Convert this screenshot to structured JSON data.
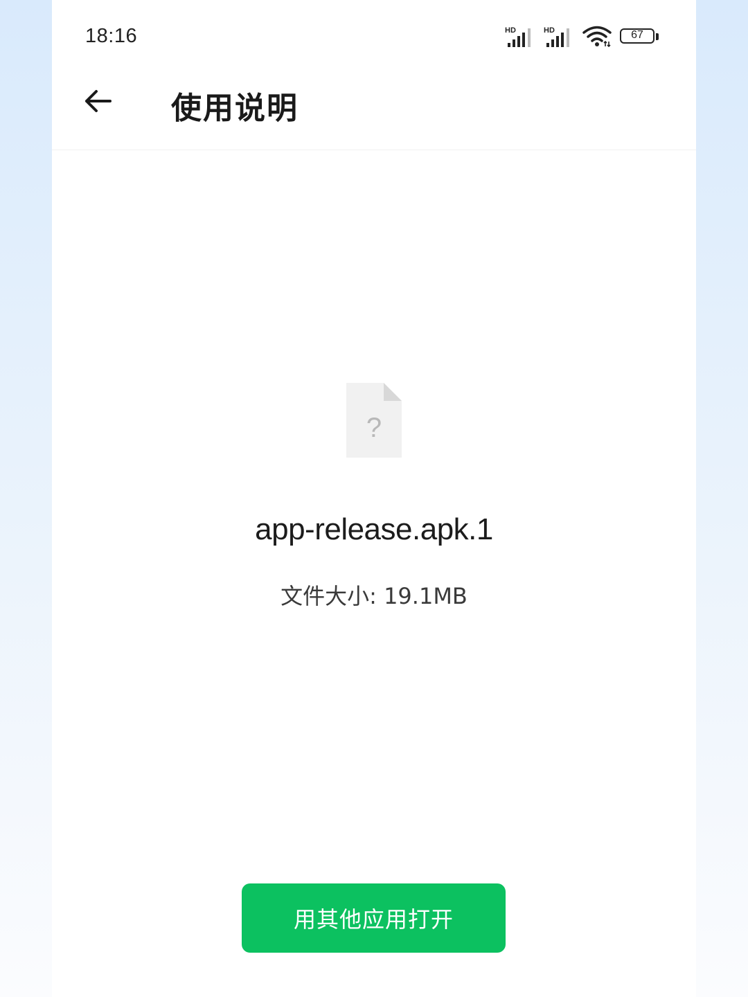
{
  "status_bar": {
    "time": "18:16",
    "signal_1_label": "HD",
    "signal_2_label": "HD",
    "battery_level": "67",
    "icons": [
      "signal-icon",
      "signal-icon",
      "wifi-icon",
      "battery-icon"
    ]
  },
  "header": {
    "back_icon": "arrow-left-icon",
    "title": "使用说明"
  },
  "file": {
    "icon": "unknown-file-icon",
    "icon_glyph": "?",
    "name": "app-release.apk.1",
    "size_text": "文件大小: 19.1MB"
  },
  "actions": {
    "open_with_other_label": "用其他应用打开",
    "button_color": "#0cc160"
  }
}
